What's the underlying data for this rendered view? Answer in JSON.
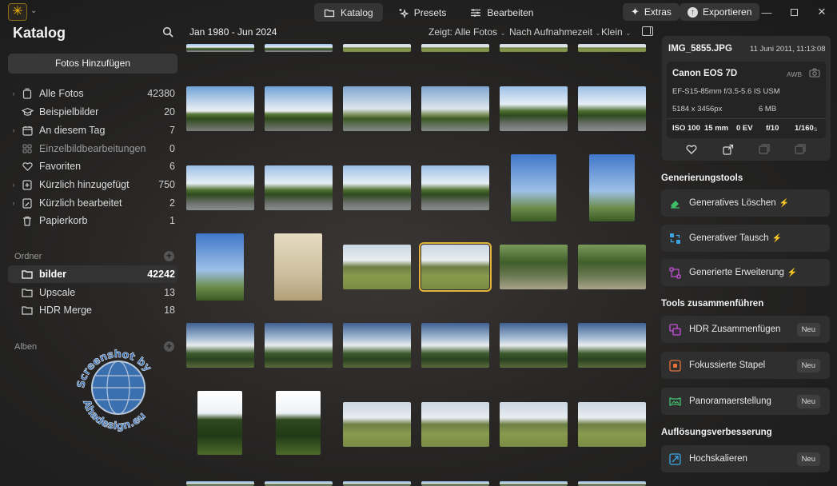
{
  "titlebar": {
    "tabs": [
      {
        "label": "Katalog",
        "icon": "folder-icon"
      },
      {
        "label": "Presets",
        "icon": "sparkle-icon"
      },
      {
        "label": "Bearbeiten",
        "icon": "sliders-icon"
      }
    ],
    "extras_label": "Extras",
    "export_label": "Exportieren",
    "accent": "#f4b400"
  },
  "sidebar": {
    "title": "Katalog",
    "add_photos_label": "Fotos Hinzufügen",
    "items": [
      {
        "label": "Alle Fotos",
        "count": "42380",
        "icon": "photos-icon",
        "chevron": true
      },
      {
        "label": "Beispielbilder",
        "count": "20",
        "icon": "graduation-cap-icon",
        "chevron": false
      },
      {
        "label": "An diesem Tag",
        "count": "7",
        "icon": "calendar-icon",
        "chevron": true
      },
      {
        "label": "Einzelbildbearbeitungen",
        "count": "0",
        "icon": "grid-icon",
        "chevron": false
      },
      {
        "label": "Favoriten",
        "count": "6",
        "icon": "heart-icon",
        "chevron": false
      },
      {
        "label": "Kürzlich hinzugefügt",
        "count": "750",
        "icon": "recent-added-icon",
        "chevron": true
      },
      {
        "label": "Kürzlich bearbeitet",
        "count": "2",
        "icon": "recent-edited-icon",
        "chevron": true
      },
      {
        "label": "Papierkorb",
        "count": "1",
        "icon": "trash-icon",
        "chevron": false
      }
    ],
    "folders_label": "Ordner",
    "folders": [
      {
        "label": "bilder",
        "count": "42242"
      },
      {
        "label": "Upscale",
        "count": "13"
      },
      {
        "label": "HDR Merge",
        "count": "18"
      }
    ],
    "albums_label": "Alben",
    "watermark_text": "Screenshot by Ahadesign.eu"
  },
  "toolbar": {
    "date_range": "Jan 1980 - Jun 2024",
    "filter_label": "Zeigt: Alle Fotos",
    "sort_label": "Nach Aufnahmezeit",
    "size_label": "Klein"
  },
  "info": {
    "filename": "IMG_5855.JPG",
    "datetime": "11 Juni 2011, 11:13:08",
    "camera": "Canon EOS 7D",
    "wb": "AWB",
    "lens": "EF-S15-85mm f/3.5-5.6 IS USM",
    "dimensions": "5184 x 3456px",
    "filesize": "6 MB",
    "iso": "ISO 100",
    "focal": "15 mm",
    "ev": "0 EV",
    "aperture": "f/10",
    "shutter": "1/160",
    "shutter_unit": "s"
  },
  "gen_tools": {
    "title": "Generierungstools",
    "items": [
      {
        "label": "Generatives Löschen",
        "icon": "eraser-icon",
        "color": "#3fbf6a",
        "bolt_color": "#3fd77a"
      },
      {
        "label": "Generativer Tausch",
        "icon": "swap-icon",
        "color": "#3aa7e8",
        "bolt_color": "#3ab0f0"
      },
      {
        "label": "Generierte Erweiterung",
        "icon": "expand-icon",
        "color": "#c452d8",
        "bolt_color": "#d060e8"
      }
    ]
  },
  "merge_tools": {
    "title": "Tools zusammenführen",
    "badge": "Neu",
    "items": [
      {
        "label": "HDR Zusammenfügen",
        "icon": "hdr-icon",
        "color": "#c452d8"
      },
      {
        "label": "Fokussierte Stapel",
        "icon": "focus-stack-icon",
        "color": "#e8743a"
      },
      {
        "label": "Panoramaerstellung",
        "icon": "panorama-icon",
        "color": "#3fbf6a"
      }
    ]
  },
  "upscale_tools": {
    "title": "Auflösungsverbesserung",
    "badge": "Neu",
    "items": [
      {
        "label": "Hochskalieren",
        "icon": "upscale-icon",
        "color": "#3aa7e8"
      }
    ]
  }
}
